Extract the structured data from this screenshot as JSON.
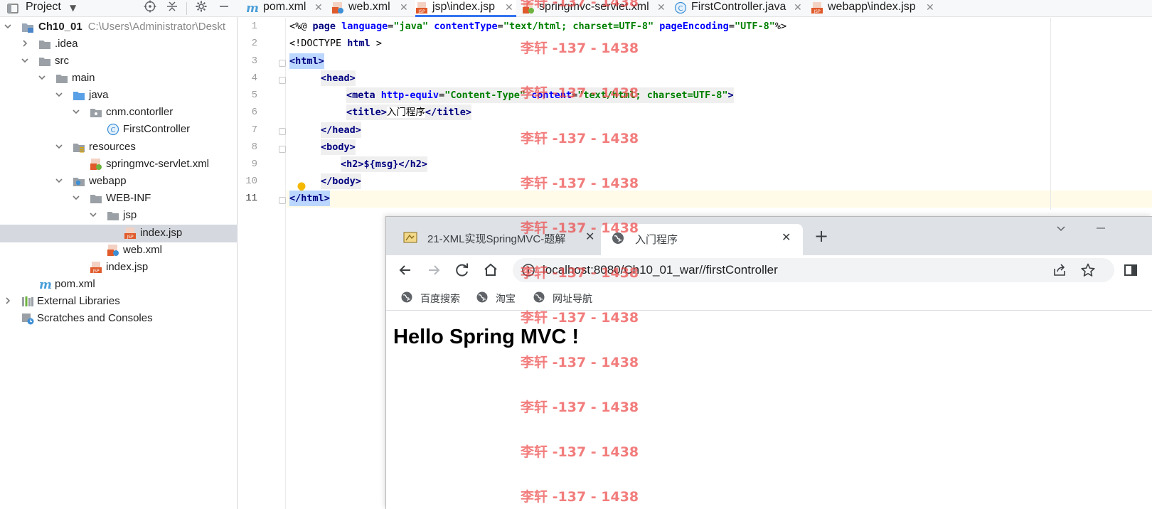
{
  "project_panel": {
    "title": "Project",
    "tree": [
      {
        "label": "Ch10_01",
        "path": "C:\\Users\\Administrator\\Deskt",
        "bold": true
      },
      {
        "label": ".idea"
      },
      {
        "label": "src"
      },
      {
        "label": "main"
      },
      {
        "label": "java"
      },
      {
        "label": "cnm.contorller"
      },
      {
        "label": "FirstController"
      },
      {
        "label": "resources"
      },
      {
        "label": "springmvc-servlet.xml"
      },
      {
        "label": "webapp"
      },
      {
        "label": "WEB-INF"
      },
      {
        "label": "jsp"
      },
      {
        "label": "index.jsp"
      },
      {
        "label": "web.xml"
      },
      {
        "label": "index.jsp"
      },
      {
        "label": "pom.xml"
      },
      {
        "label": "External Libraries"
      },
      {
        "label": "Scratches and Consoles"
      }
    ]
  },
  "editor": {
    "tabs": [
      {
        "label": "pom.xml"
      },
      {
        "label": "web.xml"
      },
      {
        "label": "jsp\\index.jsp"
      },
      {
        "label": "springmvc-servlet.xml"
      },
      {
        "label": "FirstController.java"
      },
      {
        "label": "webapp\\index.jsp"
      }
    ],
    "line_numbers": [
      "1",
      "2",
      "3",
      "4",
      "5",
      "6",
      "7",
      "8",
      "9",
      "10",
      "11"
    ],
    "code": {
      "l1": [
        "<%@ ",
        "page",
        " ",
        "language",
        "=",
        "\"java\"",
        " ",
        "contentType",
        "=",
        "\"text/html; charset=UTF-8\"",
        " ",
        "pageEncoding",
        "=",
        "\"UTF-8\"",
        "%>"
      ],
      "l2": [
        "<!DOCTYPE ",
        "html",
        " >"
      ],
      "l3": [
        "<",
        "html",
        ">"
      ],
      "l4": [
        "<",
        "head",
        ">"
      ],
      "l5": [
        "<",
        "meta ",
        "http-equiv",
        "=",
        "\"Content-Type\"",
        " ",
        "content",
        "=",
        "\"text/html; charset=UTF-8\"",
        ">"
      ],
      "l6": [
        "<",
        "title",
        ">",
        "入门程序",
        "</",
        "title",
        ">"
      ],
      "l7": [
        "</",
        "head",
        ">"
      ],
      "l8": [
        "<",
        "body",
        ">"
      ],
      "l9": [
        "<",
        "h2",
        ">",
        "${msg}",
        "</",
        "h2",
        ">"
      ],
      "l10": [
        "</",
        "body",
        ">"
      ],
      "l11": [
        "</",
        "html",
        ">"
      ]
    }
  },
  "browser": {
    "tabs": [
      {
        "label": "21-XML实现SpringMVC-题解"
      },
      {
        "label": "入门程序"
      }
    ],
    "url": "localhost:8080/Ch10_01_war//firstController",
    "bookmarks": [
      {
        "label": "百度搜索"
      },
      {
        "label": "淘宝"
      },
      {
        "label": "网址导航"
      }
    ],
    "content": {
      "heading": "Hello Spring MVC !"
    }
  },
  "watermark": {
    "text": "李轩 -137 - 1438"
  },
  "colors": {
    "accent": "#3574f0",
    "watermark": "#ec4646",
    "tag": "#000080",
    "attr_name": "#0000ff",
    "attr_value": "#008000"
  }
}
